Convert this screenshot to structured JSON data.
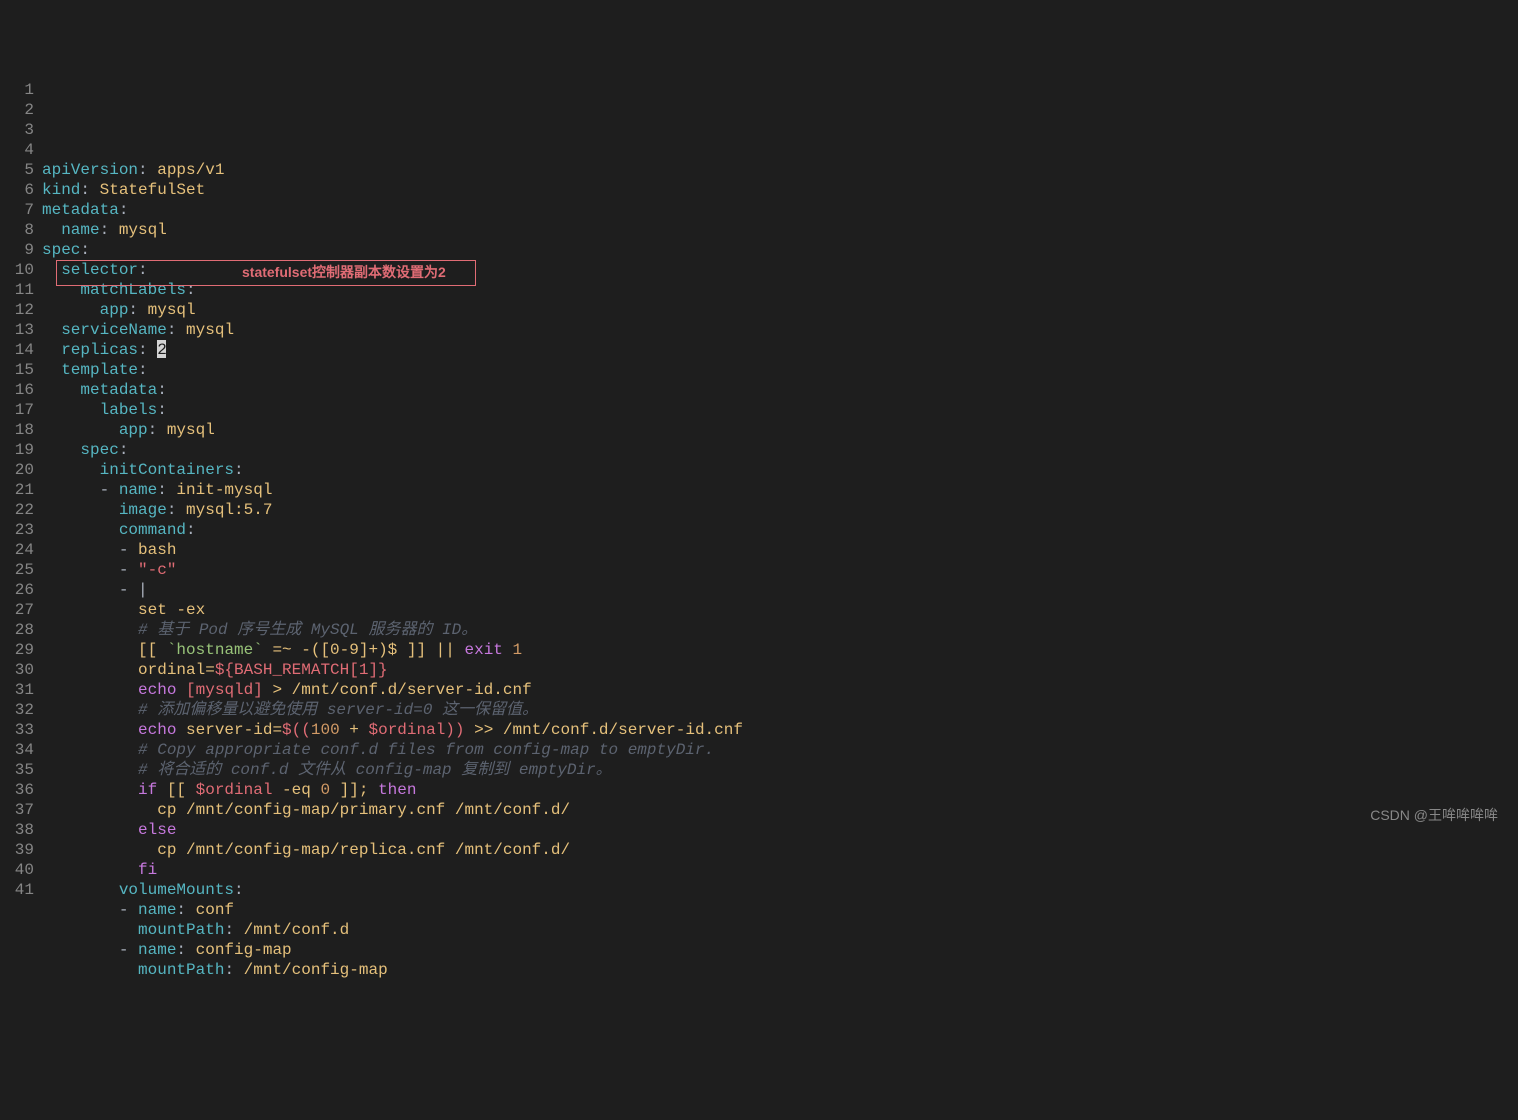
{
  "annotation": "statefulset控制器副本数设置为2",
  "watermark": "CSDN @王哞哞哞哞",
  "cursor_value": "2",
  "line_numbers": [
    "1",
    "2",
    "3",
    "4",
    "5",
    "6",
    "7",
    "8",
    "9",
    "10",
    "11",
    "12",
    "13",
    "14",
    "15",
    "16",
    "17",
    "18",
    "19",
    "20",
    "21",
    "22",
    "23",
    "24",
    "25",
    "26",
    "27",
    "28",
    "29",
    "30",
    "31",
    "32",
    "33",
    "34",
    "35",
    "36",
    "37",
    "38",
    "39",
    "40",
    "41"
  ],
  "lines": [
    {
      "tokens": [
        {
          "t": "apiVersion",
          "c": "key"
        },
        {
          "t": ": ",
          "c": "txt"
        },
        {
          "t": "apps/v1",
          "c": "val"
        }
      ]
    },
    {
      "tokens": [
        {
          "t": "kind",
          "c": "key"
        },
        {
          "t": ": ",
          "c": "txt"
        },
        {
          "t": "StatefulSet",
          "c": "val"
        }
      ]
    },
    {
      "tokens": [
        {
          "t": "metadata",
          "c": "key"
        },
        {
          "t": ":",
          "c": "txt"
        }
      ]
    },
    {
      "tokens": [
        {
          "t": "  ",
          "c": "txt"
        },
        {
          "t": "name",
          "c": "key"
        },
        {
          "t": ": ",
          "c": "txt"
        },
        {
          "t": "mysql",
          "c": "val"
        }
      ]
    },
    {
      "tokens": [
        {
          "t": "spec",
          "c": "key"
        },
        {
          "t": ":",
          "c": "txt"
        }
      ]
    },
    {
      "tokens": [
        {
          "t": "  ",
          "c": "txt"
        },
        {
          "t": "selector",
          "c": "key"
        },
        {
          "t": ":",
          "c": "txt"
        }
      ]
    },
    {
      "tokens": [
        {
          "t": "    ",
          "c": "txt"
        },
        {
          "t": "matchLabels",
          "c": "key"
        },
        {
          "t": ":",
          "c": "txt"
        }
      ]
    },
    {
      "tokens": [
        {
          "t": "      ",
          "c": "txt"
        },
        {
          "t": "app",
          "c": "key"
        },
        {
          "t": ": ",
          "c": "txt"
        },
        {
          "t": "mysql",
          "c": "val"
        }
      ]
    },
    {
      "tokens": [
        {
          "t": "  ",
          "c": "txt"
        },
        {
          "t": "serviceName",
          "c": "key"
        },
        {
          "t": ": ",
          "c": "txt"
        },
        {
          "t": "mysql",
          "c": "val"
        }
      ]
    },
    {
      "tokens": [
        {
          "t": "  ",
          "c": "txt"
        },
        {
          "t": "replicas",
          "c": "key"
        },
        {
          "t": ": ",
          "c": "txt"
        }
      ],
      "cursor": true
    },
    {
      "tokens": [
        {
          "t": "  ",
          "c": "txt"
        },
        {
          "t": "template",
          "c": "key"
        },
        {
          "t": ":",
          "c": "txt"
        }
      ]
    },
    {
      "tokens": [
        {
          "t": "    ",
          "c": "txt"
        },
        {
          "t": "metadata",
          "c": "key"
        },
        {
          "t": ":",
          "c": "txt"
        }
      ]
    },
    {
      "tokens": [
        {
          "t": "      ",
          "c": "txt"
        },
        {
          "t": "labels",
          "c": "key"
        },
        {
          "t": ":",
          "c": "txt"
        }
      ]
    },
    {
      "tokens": [
        {
          "t": "        ",
          "c": "txt"
        },
        {
          "t": "app",
          "c": "key"
        },
        {
          "t": ": ",
          "c": "txt"
        },
        {
          "t": "mysql",
          "c": "val"
        }
      ]
    },
    {
      "tokens": [
        {
          "t": "    ",
          "c": "txt"
        },
        {
          "t": "spec",
          "c": "key"
        },
        {
          "t": ":",
          "c": "txt"
        }
      ]
    },
    {
      "tokens": [
        {
          "t": "      ",
          "c": "txt"
        },
        {
          "t": "initContainers",
          "c": "key"
        },
        {
          "t": ":",
          "c": "txt"
        }
      ]
    },
    {
      "tokens": [
        {
          "t": "      ",
          "c": "txt"
        },
        {
          "t": "- ",
          "c": "dash"
        },
        {
          "t": "name",
          "c": "key"
        },
        {
          "t": ": ",
          "c": "txt"
        },
        {
          "t": "init-mysql",
          "c": "val"
        }
      ]
    },
    {
      "tokens": [
        {
          "t": "        ",
          "c": "txt"
        },
        {
          "t": "image",
          "c": "key"
        },
        {
          "t": ": ",
          "c": "txt"
        },
        {
          "t": "mysql:5.7",
          "c": "val"
        }
      ]
    },
    {
      "tokens": [
        {
          "t": "        ",
          "c": "txt"
        },
        {
          "t": "command",
          "c": "key"
        },
        {
          "t": ":",
          "c": "txt"
        }
      ]
    },
    {
      "tokens": [
        {
          "t": "        ",
          "c": "txt"
        },
        {
          "t": "- ",
          "c": "dash"
        },
        {
          "t": "bash",
          "c": "val"
        }
      ]
    },
    {
      "tokens": [
        {
          "t": "        ",
          "c": "txt"
        },
        {
          "t": "- ",
          "c": "dash"
        },
        {
          "t": "\"-c\"",
          "c": "str"
        }
      ]
    },
    {
      "tokens": [
        {
          "t": "        ",
          "c": "txt"
        },
        {
          "t": "- ",
          "c": "dash"
        },
        {
          "t": "|",
          "c": "txt"
        }
      ]
    },
    {
      "tokens": [
        {
          "t": "          ",
          "c": "txt"
        },
        {
          "t": "set -ex",
          "c": "val"
        }
      ]
    },
    {
      "tokens": [
        {
          "t": "          ",
          "c": "txt"
        },
        {
          "t": "# 基于 Pod 序号生成 MySQL 服务器的 ID。",
          "c": "comment"
        }
      ]
    },
    {
      "tokens": [
        {
          "t": "          ",
          "c": "txt"
        },
        {
          "t": "[[ ",
          "c": "val"
        },
        {
          "t": "`hostname`",
          "c": "str2"
        },
        {
          "t": " =~ -(",
          "c": "val"
        },
        {
          "t": "[0-9]",
          "c": "val"
        },
        {
          "t": "+)$ ]] || ",
          "c": "val"
        },
        {
          "t": "exit",
          "c": "kw"
        },
        {
          "t": " ",
          "c": "val"
        },
        {
          "t": "1",
          "c": "num"
        }
      ]
    },
    {
      "tokens": [
        {
          "t": "          ",
          "c": "txt"
        },
        {
          "t": "ordinal=",
          "c": "val"
        },
        {
          "t": "${BASH_REMATCH[1]}",
          "c": "str"
        }
      ]
    },
    {
      "tokens": [
        {
          "t": "          ",
          "c": "txt"
        },
        {
          "t": "echo",
          "c": "kw"
        },
        {
          "t": " ",
          "c": "val"
        },
        {
          "t": "[mysqld]",
          "c": "str"
        },
        {
          "t": " > /mnt/conf.d/server-id.cnf",
          "c": "val"
        }
      ]
    },
    {
      "tokens": [
        {
          "t": "          ",
          "c": "txt"
        },
        {
          "t": "# 添加偏移量以避免使用 server-id=0 这一保留值。",
          "c": "comment"
        }
      ]
    },
    {
      "tokens": [
        {
          "t": "          ",
          "c": "txt"
        },
        {
          "t": "echo",
          "c": "kw"
        },
        {
          "t": " server-id=",
          "c": "val"
        },
        {
          "t": "$((",
          "c": "str"
        },
        {
          "t": "100",
          "c": "num"
        },
        {
          "t": " + ",
          "c": "val"
        },
        {
          "t": "$ordinal",
          "c": "str"
        },
        {
          "t": "))",
          "c": "str"
        },
        {
          "t": " >> /mnt/conf.d/server-id.cnf",
          "c": "val"
        }
      ]
    },
    {
      "tokens": [
        {
          "t": "          ",
          "c": "txt"
        },
        {
          "t": "# Copy appropriate conf.d files from config-map to emptyDir.",
          "c": "comment"
        }
      ]
    },
    {
      "tokens": [
        {
          "t": "          ",
          "c": "txt"
        },
        {
          "t": "# 将合适的 conf.d 文件从 config-map 复制到 emptyDir。",
          "c": "comment"
        }
      ]
    },
    {
      "tokens": [
        {
          "t": "          ",
          "c": "txt"
        },
        {
          "t": "if",
          "c": "kw"
        },
        {
          "t": " [[ ",
          "c": "val"
        },
        {
          "t": "$ordinal",
          "c": "str"
        },
        {
          "t": " -eq ",
          "c": "val"
        },
        {
          "t": "0",
          "c": "num"
        },
        {
          "t": " ]]; ",
          "c": "val"
        },
        {
          "t": "then",
          "c": "kw"
        }
      ]
    },
    {
      "tokens": [
        {
          "t": "            ",
          "c": "txt"
        },
        {
          "t": "cp /mnt/config-map/primary.cnf /mnt/conf.d/",
          "c": "val"
        }
      ]
    },
    {
      "tokens": [
        {
          "t": "          ",
          "c": "txt"
        },
        {
          "t": "else",
          "c": "kw"
        }
      ]
    },
    {
      "tokens": [
        {
          "t": "            ",
          "c": "txt"
        },
        {
          "t": "cp /mnt/config-map/replica.cnf /mnt/conf.d/",
          "c": "val"
        }
      ]
    },
    {
      "tokens": [
        {
          "t": "          ",
          "c": "txt"
        },
        {
          "t": "fi",
          "c": "kw"
        }
      ]
    },
    {
      "tokens": [
        {
          "t": "        ",
          "c": "txt"
        },
        {
          "t": "volumeMounts",
          "c": "key"
        },
        {
          "t": ":",
          "c": "txt"
        }
      ]
    },
    {
      "tokens": [
        {
          "t": "        ",
          "c": "txt"
        },
        {
          "t": "- ",
          "c": "dash"
        },
        {
          "t": "name",
          "c": "key"
        },
        {
          "t": ": ",
          "c": "txt"
        },
        {
          "t": "conf",
          "c": "val"
        }
      ]
    },
    {
      "tokens": [
        {
          "t": "          ",
          "c": "txt"
        },
        {
          "t": "mountPath",
          "c": "key"
        },
        {
          "t": ": ",
          "c": "txt"
        },
        {
          "t": "/mnt/conf.d",
          "c": "val"
        }
      ]
    },
    {
      "tokens": [
        {
          "t": "        ",
          "c": "txt"
        },
        {
          "t": "- ",
          "c": "dash"
        },
        {
          "t": "name",
          "c": "key"
        },
        {
          "t": ": ",
          "c": "txt"
        },
        {
          "t": "config-map",
          "c": "val"
        }
      ]
    },
    {
      "tokens": [
        {
          "t": "          ",
          "c": "txt"
        },
        {
          "t": "mountPath",
          "c": "key"
        },
        {
          "t": ": ",
          "c": "txt"
        },
        {
          "t": "/mnt/config-map",
          "c": "val"
        }
      ]
    }
  ]
}
